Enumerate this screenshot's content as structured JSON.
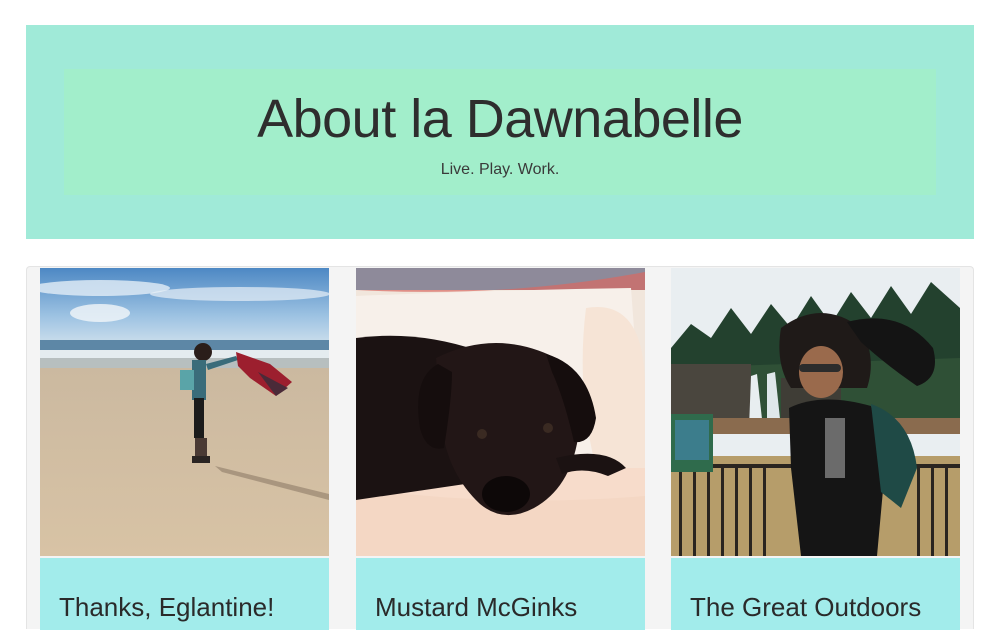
{
  "header": {
    "title": "About la Dawnabelle",
    "subtitle": "Live. Play. Work."
  },
  "cards": [
    {
      "title": "Thanks, Eglantine!",
      "image": "beach-photo"
    },
    {
      "title": "Mustard McGinks",
      "image": "puppy-photo"
    },
    {
      "title": "The Great Outdoors",
      "image": "waterfall-photo"
    }
  ],
  "colors": {
    "header_bg": "#a0ead8",
    "header_inner_bg": "#a2eecb",
    "caption_bg": "#a2eceb",
    "card_area_bg": "#f4f4f4"
  }
}
